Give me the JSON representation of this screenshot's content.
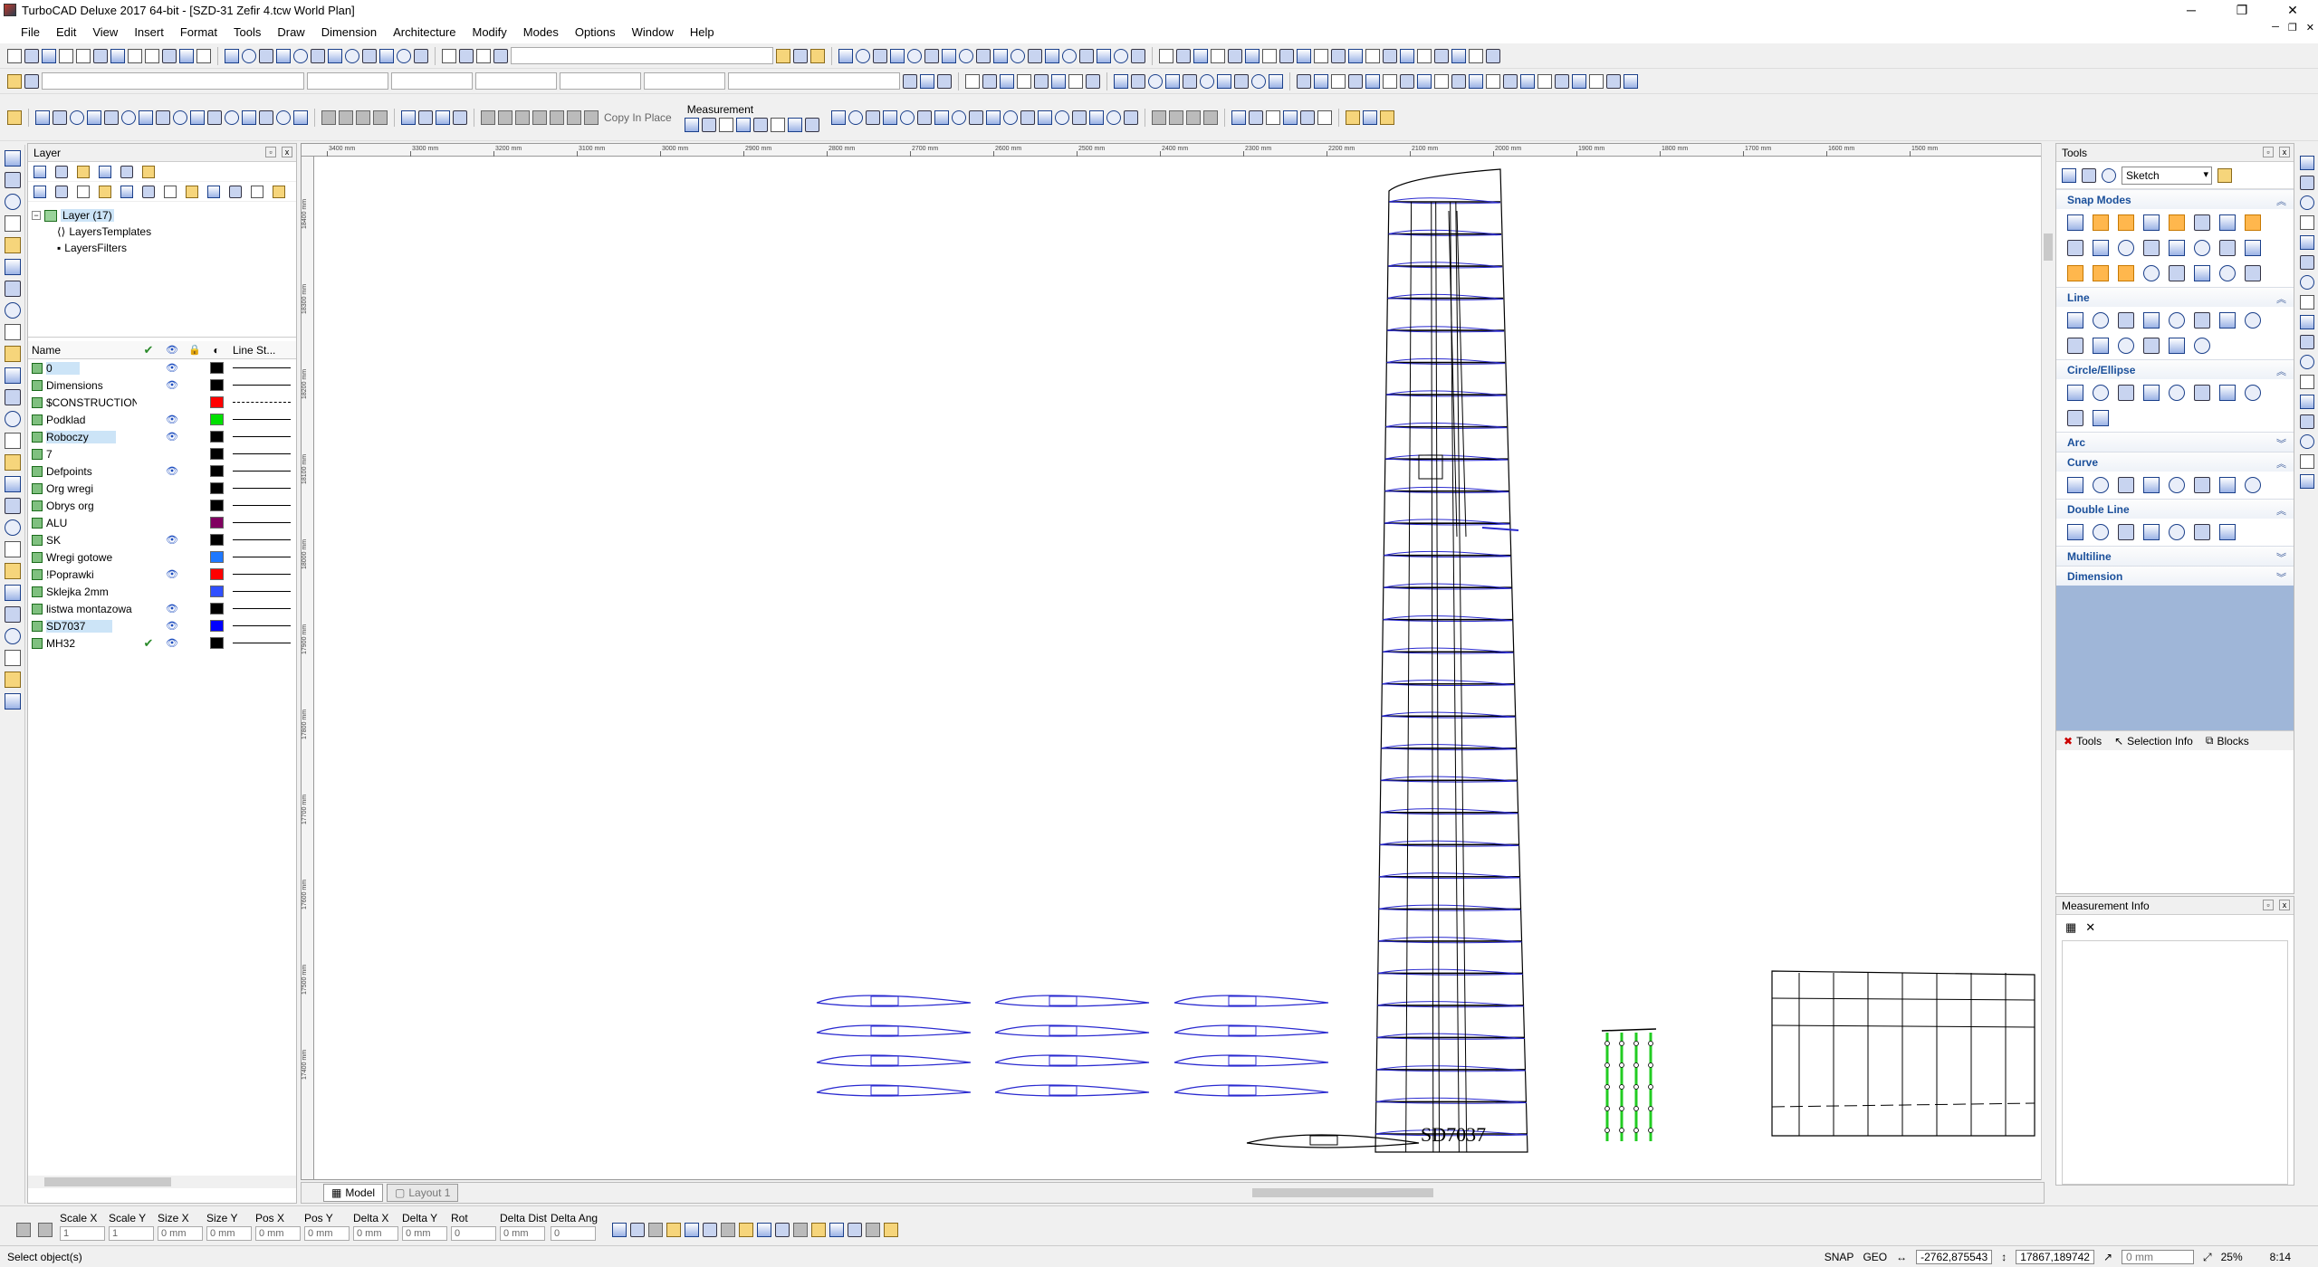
{
  "window": {
    "title": "TurboCAD Deluxe 2017 64-bit - [SZD-31 Zefir 4.tcw World Plan]",
    "minimize": "─",
    "maximize": "❐",
    "close": "✕"
  },
  "menu": [
    "File",
    "Edit",
    "View",
    "Insert",
    "Format",
    "Tools",
    "Draw",
    "Dimension",
    "Architecture",
    "Modify",
    "Modes",
    "Options",
    "Window",
    "Help"
  ],
  "toolbars": {
    "copy_in_place": "Copy In Place",
    "measurement": "Measurement"
  },
  "layer_panel": {
    "title": "Layer",
    "tree": {
      "root": "Layer (17)",
      "children": [
        "LayersTemplates",
        "LayersFilters"
      ]
    },
    "columns": {
      "name": "Name",
      "line_style": "Line St..."
    },
    "rows": [
      {
        "name": "0",
        "visible": true,
        "current": false,
        "color": "#000000",
        "style": "solid",
        "highlight": true
      },
      {
        "name": "Dimensions",
        "visible": true,
        "current": false,
        "color": "#000000",
        "style": "solid",
        "highlight": false
      },
      {
        "name": "$CONSTRUCTION",
        "visible": false,
        "current": false,
        "color": "#ff0000",
        "style": "dash",
        "highlight": false
      },
      {
        "name": "Podklad",
        "visible": true,
        "current": false,
        "color": "#00e000",
        "style": "solid",
        "highlight": false
      },
      {
        "name": "Roboczy",
        "visible": true,
        "current": false,
        "color": "#000000",
        "style": "solid",
        "highlight": true
      },
      {
        "name": "7",
        "visible": false,
        "current": false,
        "color": "#000000",
        "style": "solid",
        "highlight": false
      },
      {
        "name": "Defpoints",
        "visible": true,
        "current": false,
        "color": "#000000",
        "style": "solid",
        "highlight": false
      },
      {
        "name": "Org wregi",
        "visible": false,
        "current": false,
        "color": "#000000",
        "style": "solid",
        "highlight": false
      },
      {
        "name": "Obrys org",
        "visible": false,
        "current": false,
        "color": "#000000",
        "style": "solid",
        "highlight": false
      },
      {
        "name": "ALU",
        "visible": false,
        "current": false,
        "color": "#800060",
        "style": "solid",
        "highlight": false
      },
      {
        "name": "SK",
        "visible": true,
        "current": false,
        "color": "#000000",
        "style": "solid",
        "highlight": false
      },
      {
        "name": "Wregi gotowe",
        "visible": false,
        "current": false,
        "color": "#1e78ff",
        "style": "solid",
        "highlight": false
      },
      {
        "name": "!Poprawki",
        "visible": true,
        "current": false,
        "color": "#ff0000",
        "style": "solid",
        "highlight": false
      },
      {
        "name": "Sklejka 2mm",
        "visible": false,
        "current": false,
        "color": "#3050ff",
        "style": "solid",
        "highlight": false
      },
      {
        "name": "listwa montazowa",
        "visible": true,
        "current": false,
        "color": "#000000",
        "style": "solid",
        "highlight": false
      },
      {
        "name": "SD7037",
        "visible": true,
        "current": false,
        "color": "#0000ff",
        "style": "solid",
        "highlight": true
      },
      {
        "name": "MH32",
        "visible": true,
        "current": true,
        "color": "#000000",
        "style": "solid",
        "highlight": false
      }
    ]
  },
  "drawing": {
    "label": "SD7037",
    "ruler_top": [
      "3400 mm",
      "3300 mm",
      "3200 mm",
      "3100 mm",
      "3000 mm",
      "2900 mm",
      "2800 mm",
      "2700 mm",
      "2600 mm",
      "2500 mm",
      "2400 mm",
      "2300 mm",
      "2200 mm",
      "2100 mm",
      "2000 mm",
      "1900 mm",
      "1800 mm",
      "1700 mm",
      "1600 mm",
      "1500 mm"
    ],
    "ruler_left": [
      "18400 mm",
      "18300 mm",
      "18200 mm",
      "18100 mm",
      "18000 mm",
      "17900 mm",
      "17800 mm",
      "17700 mm",
      "17600 mm",
      "17500 mm",
      "17400 mm"
    ]
  },
  "tabs": [
    "Model",
    "Layout 1"
  ],
  "tools_panel": {
    "title": "Tools",
    "mode": "Sketch",
    "sections": [
      {
        "name": "Snap Modes",
        "open": true,
        "count": 24
      },
      {
        "name": "Line",
        "open": true,
        "count": 14
      },
      {
        "name": "Circle/Ellipse",
        "open": true,
        "count": 10
      },
      {
        "name": "Arc",
        "open": false,
        "count": 0
      },
      {
        "name": "Curve",
        "open": true,
        "count": 8
      },
      {
        "name": "Double Line",
        "open": true,
        "count": 7
      },
      {
        "name": "Multiline",
        "open": false,
        "count": 0
      },
      {
        "name": "Dimension",
        "open": false,
        "count": 0
      }
    ],
    "bottom_tabs": [
      "Tools",
      "Selection Info",
      "Blocks"
    ]
  },
  "measurement_panel": {
    "title": "Measurement Info"
  },
  "inspector": {
    "fields": [
      {
        "label": "Scale X",
        "value": "1"
      },
      {
        "label": "Scale Y",
        "value": "1"
      },
      {
        "label": "Size X",
        "value": "0 mm"
      },
      {
        "label": "Size Y",
        "value": "0 mm"
      },
      {
        "label": "Pos X",
        "value": "0 mm"
      },
      {
        "label": "Pos Y",
        "value": "0 mm"
      },
      {
        "label": "Delta X",
        "value": "0 mm"
      },
      {
        "label": "Delta Y",
        "value": "0 mm"
      },
      {
        "label": "Rot",
        "value": "0"
      },
      {
        "label": "Delta Dist",
        "value": "0 mm"
      },
      {
        "label": "Delta Ang",
        "value": "0"
      }
    ]
  },
  "status": {
    "message": "Select object(s)",
    "snap": "SNAP",
    "geo": "GEO",
    "coord_x": "-2762,875543",
    "coord_y": "17867,189742",
    "dist": "0 mm",
    "zoom": "25%",
    "time": "8:14"
  }
}
